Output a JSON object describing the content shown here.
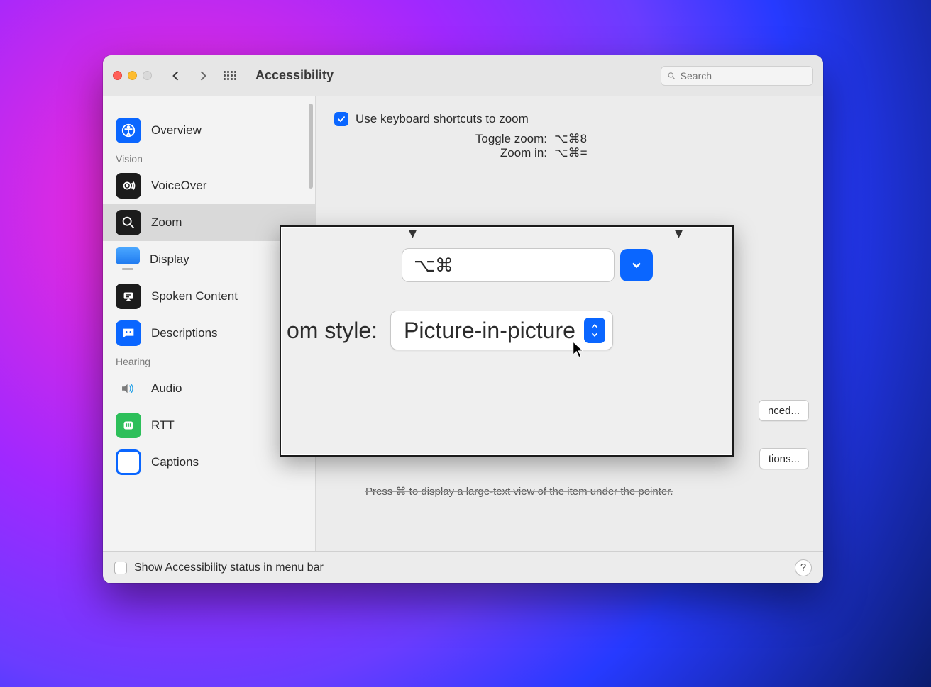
{
  "titlebar": {
    "title": "Accessibility",
    "search_placeholder": "Search"
  },
  "sidebar": {
    "sections": {
      "vision": "Vision",
      "hearing": "Hearing"
    },
    "items": {
      "overview": "Overview",
      "voiceover": "VoiceOver",
      "zoom": "Zoom",
      "display": "Display",
      "spoken_content": "Spoken Content",
      "descriptions": "Descriptions",
      "audio": "Audio",
      "rtt": "RTT",
      "captions": "Captions"
    }
  },
  "content": {
    "use_kb_label": "Use keyboard shortcuts to zoom",
    "rows": {
      "toggle_label": "Toggle zoom:",
      "toggle_value": "⌥⌘8",
      "zoomin_label": "Zoom in:",
      "zoomin_value": "⌥⌘="
    },
    "advanced_button": "nced...",
    "options_button": "tions...",
    "hint": "Press ⌘ to display a large-text view of the item under the pointer."
  },
  "pip": {
    "modifier_value": "⌥⌘",
    "zoom_style_label": "om style:",
    "zoom_style_value": "Picture-in-picture"
  },
  "footer": {
    "menu_bar_label": "Show Accessibility status in menu bar",
    "help": "?"
  }
}
